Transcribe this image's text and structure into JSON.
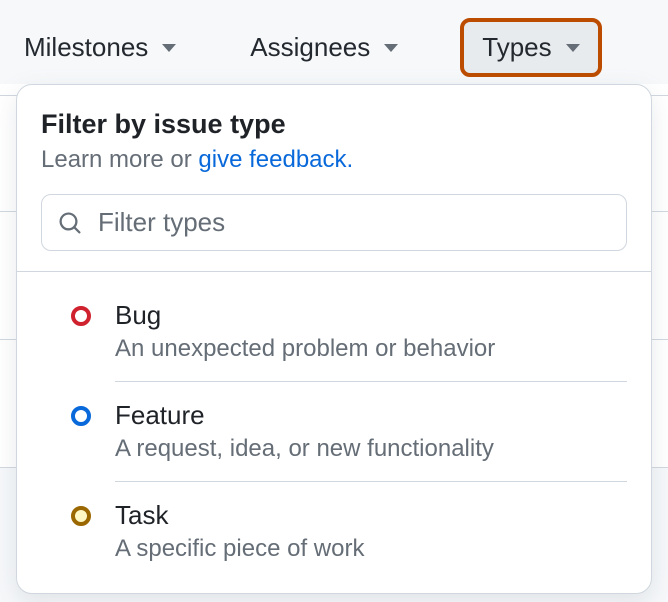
{
  "filters": {
    "milestones": "Milestones",
    "assignees": "Assignees",
    "types": "Types"
  },
  "panel": {
    "title": "Filter by issue type",
    "subtitle_prefix": "Learn more or ",
    "feedback_link": "give feedback.",
    "search_placeholder": "Filter types"
  },
  "types": [
    {
      "name": "Bug",
      "description": "An unexpected problem or behavior",
      "color_class": "bug"
    },
    {
      "name": "Feature",
      "description": "A request, idea, or new functionality",
      "color_class": "feature"
    },
    {
      "name": "Task",
      "description": "A specific piece of work",
      "color_class": "task"
    }
  ]
}
